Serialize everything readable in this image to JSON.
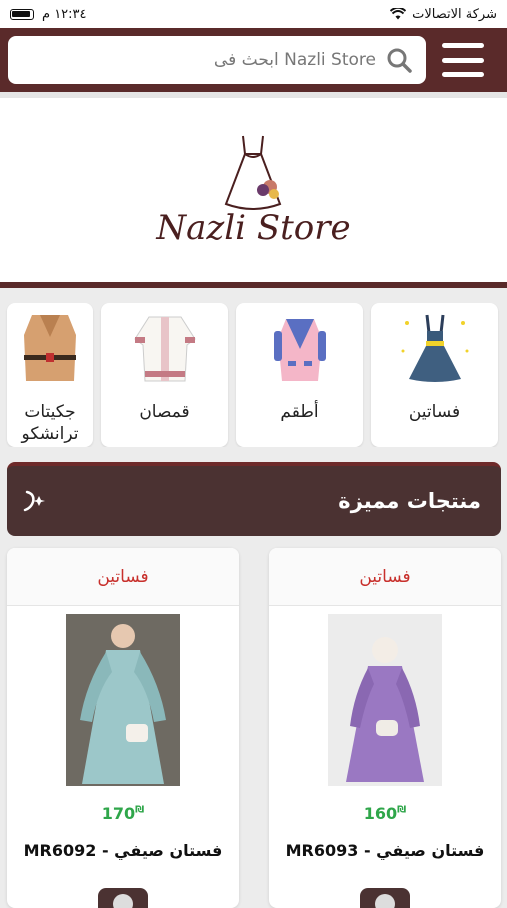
{
  "status": {
    "carrier": "شركة الاتصالات",
    "time": "١٢:٣٤ م"
  },
  "search": {
    "placeholder": "ابحث فى Nazli Store"
  },
  "banner": {
    "logo_text": "Nazli Store"
  },
  "categories": [
    {
      "label": "فساتين",
      "icon": "dress-icon"
    },
    {
      "label": "أطقم",
      "icon": "suit-icon"
    },
    {
      "label": "قمصان",
      "icon": "shirt-icon"
    },
    {
      "label": "جكيتات ترانشكو",
      "icon": "trench-coat-icon"
    }
  ],
  "featured": {
    "title": "منتجات مميزة"
  },
  "products": [
    {
      "category": "فساتين",
      "price": "160",
      "currency": "₪",
      "name": "فستان صيفي - MR6093",
      "color": "#9a78c2"
    },
    {
      "category": "فساتين",
      "price": "170",
      "currency": "₪",
      "name": "فستان صيفي - MR6092",
      "color": "#9cc7c9"
    }
  ],
  "colors": {
    "brand": "#5a2a2a",
    "accent_price": "#2fa64a",
    "category_red": "#c8302c"
  }
}
